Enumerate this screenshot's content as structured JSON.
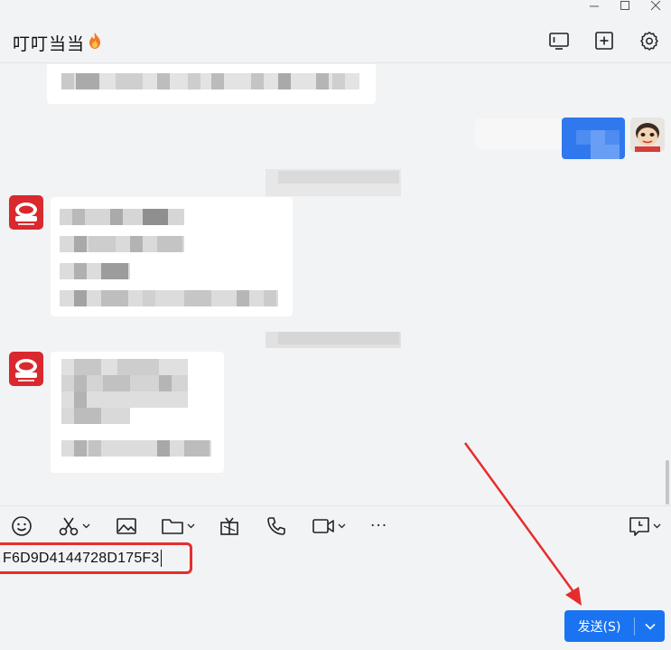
{
  "window": {
    "controls": [
      "minimize-icon",
      "maximize-icon",
      "close-icon"
    ]
  },
  "header": {
    "title": "叮叮当当",
    "title_emoji": "🔥",
    "actions": [
      "screen-share-icon",
      "add-member-icon",
      "settings-icon"
    ]
  },
  "toolbar": {
    "items": [
      "emoji-icon",
      "scissors-icon",
      "image-icon",
      "folder-icon",
      "gift-icon",
      "phone-icon",
      "video-icon",
      "more-icon",
      "history-icon"
    ],
    "more_label": "···"
  },
  "input": {
    "value": "F6D9D4144728D175F3"
  },
  "send": {
    "label": "发送(S)",
    "dropdown_icon": "chevron-down-icon"
  },
  "colors": {
    "accent": "#1a73f0",
    "annotation": "#e52d2d",
    "background": "#f2f3f5"
  }
}
